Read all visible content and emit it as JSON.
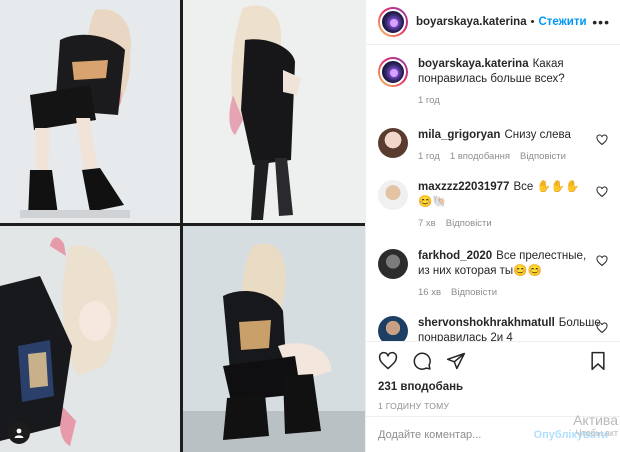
{
  "post": {
    "username": "boyarskaya.katerina",
    "dot": "•",
    "follow_label": "Стежити",
    "more": "•••"
  },
  "caption": {
    "username": "boyarskaya.katerina",
    "text": "Какая понравилась больше всех?",
    "time": "1 год"
  },
  "comments": [
    {
      "username": "mila_grigoryan",
      "text": "Снизу слева",
      "time": "1 год",
      "likes": "1 вподобання",
      "reply": "Відповісти"
    },
    {
      "username": "maxzzz22031977",
      "text": "Все ✋✋✋😊🐚",
      "time": "7 хв",
      "likes": "",
      "reply": "Відповісти"
    },
    {
      "username": "farkhod_2020",
      "text": "Все прелестные, из них которая ты😊😊",
      "time": "16 хв",
      "likes": "",
      "reply": "Відповісти"
    },
    {
      "username": "shervonshokhrakhmatull",
      "text": "Больше понравилась 2и 4",
      "time": "",
      "likes": "",
      "reply": ""
    }
  ],
  "actions": {
    "like_icon": "heart-icon",
    "comment_icon": "comment-icon",
    "share_icon": "share-icon",
    "save_icon": "bookmark-icon"
  },
  "likes_count": "231 вподобань",
  "posted_time": "1 ГОДИНУ ТОМУ",
  "add_comment": {
    "placeholder": "Додайте коментар...",
    "post_label": "Опублікувати"
  },
  "watermark": {
    "line1": "Актива",
    "line2": "Чтобы акт"
  },
  "colors": {
    "accent": "#0095f6",
    "text": "#262626",
    "muted": "#8e8e8e",
    "border": "#efefef"
  }
}
